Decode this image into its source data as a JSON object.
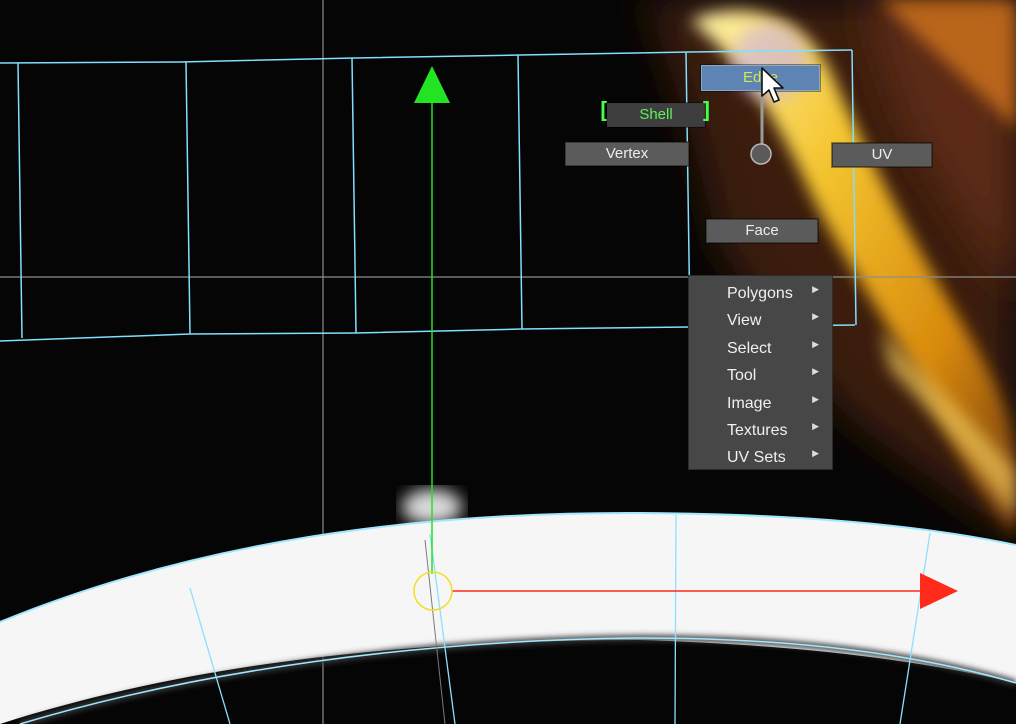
{
  "marking_menu": {
    "north_label": "Edge",
    "northwest_label": "Shell",
    "west_label": "Vertex",
    "east_label": "UV",
    "south_label": "Face"
  },
  "context_menu": {
    "items": [
      {
        "label": "Polygons"
      },
      {
        "label": "View"
      },
      {
        "label": "Select"
      },
      {
        "label": "Tool"
      },
      {
        "label": "Image"
      },
      {
        "label": "Textures"
      },
      {
        "label": "UV Sets"
      }
    ]
  },
  "colors": {
    "uv_wireframe": "#7fe0ff",
    "y_axis_handle": "#22e422",
    "x_axis_handle": "#ff2a1a",
    "pivot": "#f0e020",
    "highlight": "#c6aef0"
  },
  "icons": [
    "pointer-cursor-icon",
    "submenu-arrow-icon",
    "pivot-icon"
  ]
}
